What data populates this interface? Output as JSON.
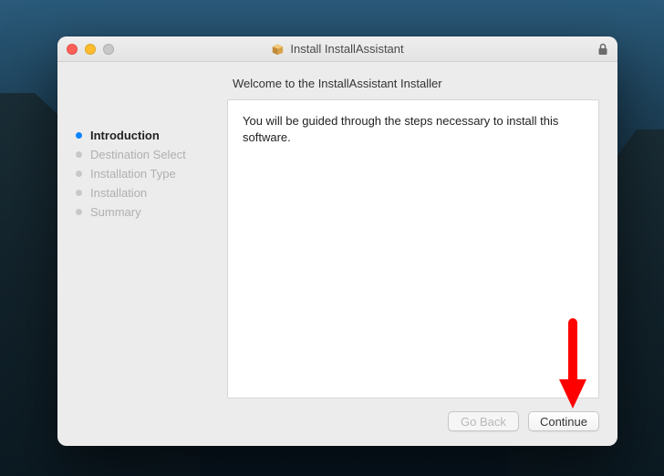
{
  "window": {
    "title": "Install InstallAssistant"
  },
  "heading": "Welcome to the InstallAssistant Installer",
  "body_text": "You will be guided through the steps necessary to install this software.",
  "sidebar": {
    "items": [
      {
        "label": "Introduction"
      },
      {
        "label": "Destination Select"
      },
      {
        "label": "Installation Type"
      },
      {
        "label": "Installation"
      },
      {
        "label": "Summary"
      }
    ],
    "active_index": 0
  },
  "buttons": {
    "go_back": "Go Back",
    "continue": "Continue"
  },
  "icons": {
    "package": "package-icon",
    "lock": "lock-icon"
  },
  "annotation": {
    "arrow_color": "#ff0000"
  }
}
